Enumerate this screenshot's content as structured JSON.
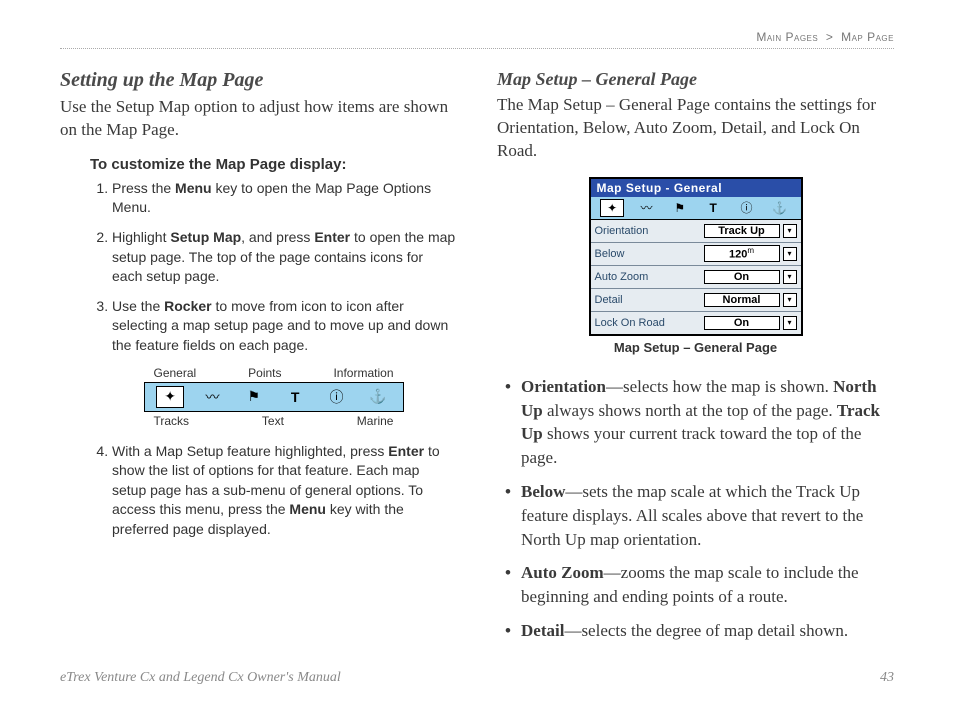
{
  "breadcrumb": {
    "section": "Main Pages",
    "sep": ">",
    "page": "Map Page"
  },
  "left": {
    "title": "Setting up the Map Page",
    "intro": "Use the Setup Map option to adjust how items are shown on the Map Page.",
    "stepsHeading": "To customize the Map Page display:",
    "step1_a": "Press the ",
    "step1_b": "Menu",
    "step1_c": " key to open the Map Page Options Menu.",
    "step2_a": "Highlight ",
    "step2_b": "Setup Map",
    "step2_c": ", and press ",
    "step2_d": "Enter",
    "step2_e": " to open the map setup page. The top of the page contains icons for each setup page.",
    "step3_a": "Use the ",
    "step3_b": "Rocker",
    "step3_c": " to move from icon to icon after selecting a map setup page and to move up and down the feature fields on each page.",
    "step4_a": "With a Map Setup feature highlighted, press ",
    "step4_b": "Enter",
    "step4_c": " to show the list of options for that feature. Each map setup page has a sub-menu of general options. To access this menu, press the ",
    "step4_d": "Menu",
    "step4_e": " key with the preferred page displayed.",
    "iconLabels": {
      "top1": "General",
      "top2": "Points",
      "top3": "Information",
      "bot1": "Tracks",
      "bot2": "Text",
      "bot3": "Marine"
    }
  },
  "right": {
    "title": "Map Setup – General Page",
    "intro": "The Map Setup – General Page contains the settings for Orientation, Below, Auto Zoom, Detail, and Lock On Road.",
    "deviceTitle": "Map Setup - General",
    "caption": "Map Setup – General Page",
    "rows": {
      "r1l": "Orientation",
      "r1v": "Track Up",
      "r2l": "Below",
      "r2v": "120",
      "r2u": "m",
      "r3l": "Auto Zoom",
      "r3v": "On",
      "r4l": "Detail",
      "r4v": "Normal",
      "r5l": "Lock On Road",
      "r5v": "On"
    },
    "b1_a": "Orientation",
    "b1_b": "—selects how the map is shown. ",
    "b1_c": "North Up",
    "b1_d": " always shows north at the top of the page. ",
    "b1_e": "Track Up",
    "b1_f": " shows your current track toward the top of the page.",
    "b2_a": "Below",
    "b2_b": "—sets the map scale at which the Track Up feature displays. All scales above that revert to the North Up map orientation.",
    "b3_a": "Auto Zoom",
    "b3_b": "—zooms the map scale to include the beginning and ending points of a route.",
    "b4_a": "Detail",
    "b4_b": "—selects the degree of map detail shown."
  },
  "footer": {
    "left": "eTrex Venture Cx and Legend Cx Owner's Manual",
    "right": "43"
  }
}
